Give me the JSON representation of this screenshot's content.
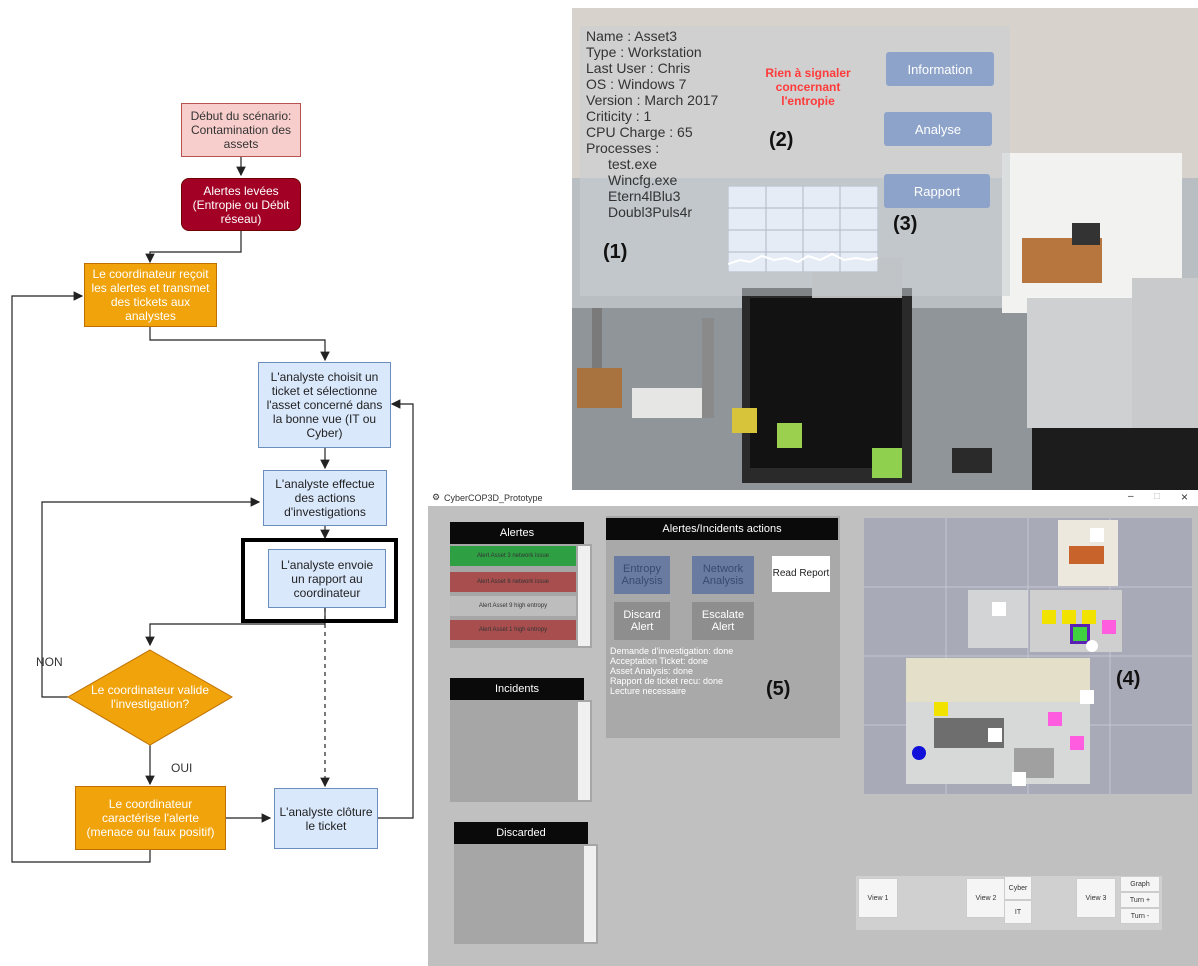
{
  "flowchart": {
    "start": "Début du scénario: Contamination des assets",
    "alerts": "Alertes levées (Entropie ou Débit réseau)",
    "coordinator_receives": "Le coordinateur reçoit les alertes et transmet des tickets aux analystes",
    "analyst_chooses": "L'analyste choisit un ticket et sélectionne l'asset concerné dans la bonne vue (IT ou Cyber)",
    "analyst_investigates": "L'analyste effectue des actions d'investigations",
    "analyst_reports": "L'analyste envoie un rapport au coordinateur",
    "decision": "Le coordinateur valide l'investigation?",
    "no_label": "NON",
    "yes_label": "OUI",
    "coordinator_characterizes": "Le coordinateur caractérise l'alerte (menace ou faux positif)",
    "analyst_closes": "L'analyste clôture le ticket"
  },
  "scene": {
    "info_lines": [
      "Name : Asset3",
      "Type : Workstation",
      "Last User : Chris",
      "OS : Windows 7",
      "Version : March 2017",
      "Criticity : 1",
      "CPU Charge : 65",
      "Processes :"
    ],
    "processes": [
      "test.exe",
      "Wincfg.exe",
      "Etern4lBlu3",
      "Doubl3Puls4r"
    ],
    "entropy_status": "Rien à signaler concernant l'entropie",
    "btn_information": "Information",
    "btn_analyse": "Analyse",
    "btn_rapport": "Rapport",
    "callout_1": "(1)",
    "callout_2": "(2)",
    "callout_3": "(3)"
  },
  "app": {
    "title": "CyberCOP3D_Prototype",
    "window_controls": {
      "minimize": "–",
      "maximize": "□",
      "close": "×"
    },
    "alerts_header": "Alertes",
    "alerts": [
      {
        "label": "Alert Asset 3 network issue",
        "color": "#2ea043"
      },
      {
        "label": "Alert Asset 6 network issue",
        "color": "#a84e4e"
      },
      {
        "label": "Alert Asset 9 high entropy",
        "color": "#bdbdbd"
      },
      {
        "label": "Alert Asset 1 high entropy",
        "color": "#a84e4e"
      }
    ],
    "incidents_header": "Incidents",
    "discarded_header": "Discarded",
    "actions_header": "Alertes/Incidents actions",
    "btn_entropy": "Entropy Analysis",
    "btn_network": "Network Analysis",
    "btn_read_report": "Read Report",
    "btn_discard": "Discard Alert",
    "btn_escalate": "Escalate Alert",
    "status_lines": [
      "Demande d'investigation: done",
      "Acceptation Ticket: done",
      "Asset Analysis: done",
      "Rapport de ticket recu: done",
      "Lecture necessaire"
    ],
    "callout_4": "(4)",
    "callout_5": "(5)",
    "view1": "View 1",
    "view2": "View 2",
    "view3": "View 3",
    "cyber": "Cyber",
    "it": "IT",
    "graph": "Graph",
    "turn_plus": "Turn +",
    "turn_minus": "Turn -"
  }
}
